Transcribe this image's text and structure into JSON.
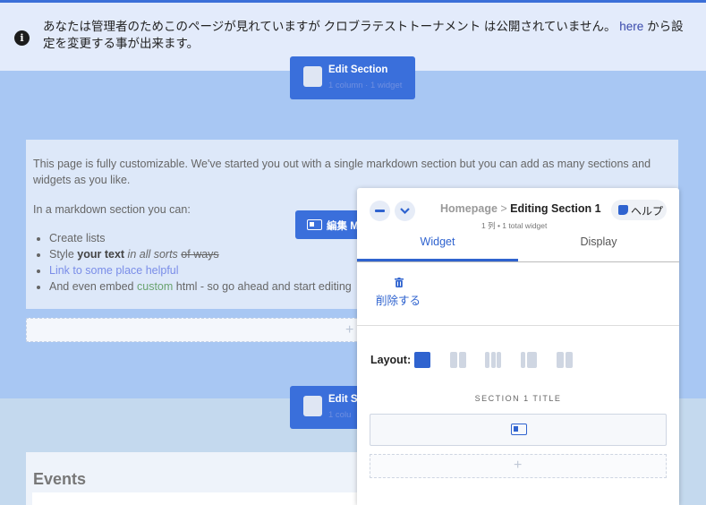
{
  "notice": {
    "message_part1": "あなたは管理者のためこのページが見れていますが クロブラテストトーナメント は公開されていません。",
    "link_text": "here",
    "message_part2": "から設定を変更する事が出来ます。"
  },
  "section1_button": {
    "label": "Edit Section",
    "sub": "1 column · 1 widget"
  },
  "section2_button": {
    "label": "Edit Se",
    "sub": "1 colu"
  },
  "markdown": {
    "p1": "This page is fully customizable. We've started you out with a single markdown section but you can add as many sections and widgets as you like.",
    "p2": "In a markdown section you can:",
    "item1": "Create lists",
    "item2_a": "Style ",
    "item2_b": "your text",
    "item2_c": " in all sorts",
    "item2_d": "of ways",
    "item3": "Link to some place helpful",
    "item4_a": "And even embed ",
    "item4_b": "custom",
    "item4_c": " html - so go ahead and start editing"
  },
  "edit_markdown_button": {
    "label": "編集 M"
  },
  "add_widget_plus": "+",
  "events": {
    "title": "Events"
  },
  "panel": {
    "breadcrumb_parent": "Homepage",
    "breadcrumb_sep": " > ",
    "breadcrumb_current": "Editing Section 1",
    "subtitle": "1 列 • 1 total widget",
    "help_label": "ヘルプ",
    "tabs": [
      "Widget",
      "Display"
    ],
    "delete_label": "削除する",
    "layout_label": "Layout:",
    "section_title_label": "SECTION 1 TITLE",
    "add_plus": "+"
  },
  "colors": {
    "accent": "#2f63cf",
    "section_bg": "#a8c7f3",
    "notice_bg": "#e3ebfb"
  }
}
